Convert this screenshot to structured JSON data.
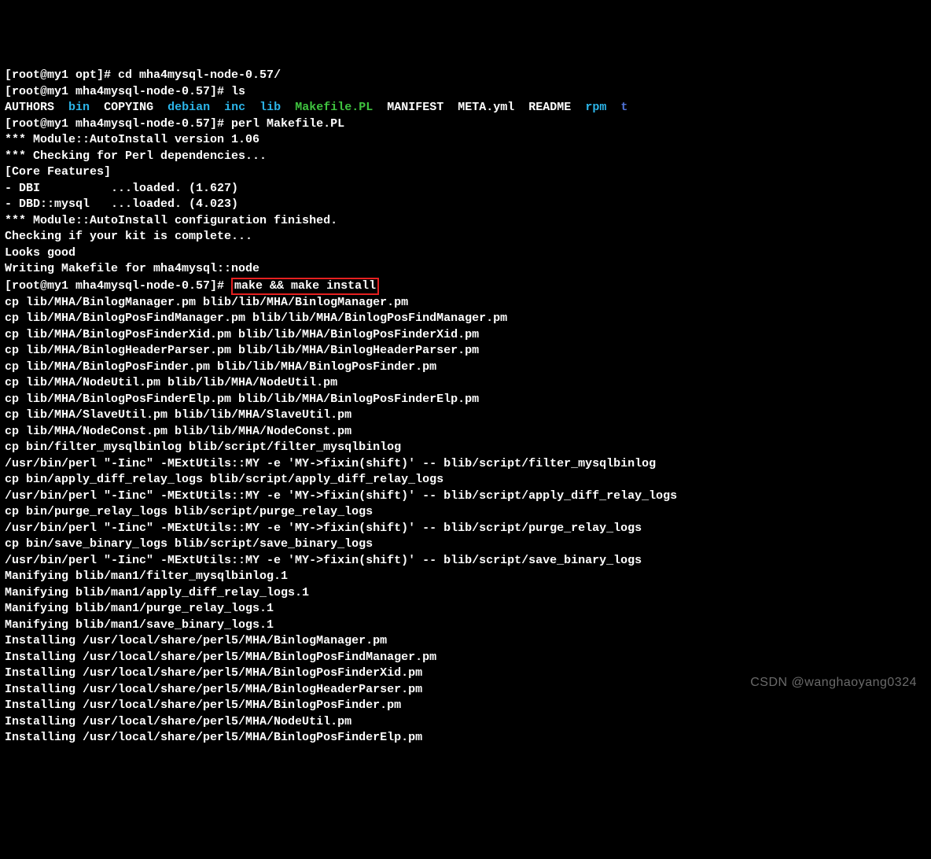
{
  "prompt1": {
    "pre": "[root@my1 opt]# ",
    "cmd": "cd mha4mysql-node-0.57/"
  },
  "prompt2": {
    "pre": "[root@my1 mha4mysql-node-0.57]# ",
    "cmd": "ls"
  },
  "ls": {
    "authors": "AUTHORS",
    "bin": "bin",
    "copying": "COPYING",
    "debian": "debian",
    "inc": "inc",
    "lib": "lib",
    "makefile": "Makefile.PL",
    "manifest": "MANIFEST",
    "metayml": "META.yml",
    "readme": "README",
    "rpm": "rpm",
    "t": "t"
  },
  "prompt3": {
    "pre": "[root@my1 mha4mysql-node-0.57]# ",
    "cmd": "perl Makefile.PL"
  },
  "perl_out": [
    "*** Module::AutoInstall version 1.06",
    "*** Checking for Perl dependencies...",
    "[Core Features]",
    "- DBI          ...loaded. (1.627)",
    "- DBD::mysql   ...loaded. (4.023)",
    "*** Module::AutoInstall configuration finished.",
    "Checking if your kit is complete...",
    "Looks good",
    "Writing Makefile for mha4mysql::node"
  ],
  "prompt4": {
    "pre": "[root@my1 mha4mysql-node-0.57]# ",
    "cmd": "make && make install"
  },
  "make_out": [
    "cp lib/MHA/BinlogManager.pm blib/lib/MHA/BinlogManager.pm",
    "cp lib/MHA/BinlogPosFindManager.pm blib/lib/MHA/BinlogPosFindManager.pm",
    "cp lib/MHA/BinlogPosFinderXid.pm blib/lib/MHA/BinlogPosFinderXid.pm",
    "cp lib/MHA/BinlogHeaderParser.pm blib/lib/MHA/BinlogHeaderParser.pm",
    "cp lib/MHA/BinlogPosFinder.pm blib/lib/MHA/BinlogPosFinder.pm",
    "cp lib/MHA/NodeUtil.pm blib/lib/MHA/NodeUtil.pm",
    "cp lib/MHA/BinlogPosFinderElp.pm blib/lib/MHA/BinlogPosFinderElp.pm",
    "cp lib/MHA/SlaveUtil.pm blib/lib/MHA/SlaveUtil.pm",
    "cp lib/MHA/NodeConst.pm blib/lib/MHA/NodeConst.pm",
    "cp bin/filter_mysqlbinlog blib/script/filter_mysqlbinlog",
    "/usr/bin/perl \"-Iinc\" -MExtUtils::MY -e 'MY->fixin(shift)' -- blib/script/filter_mysqlbinlog",
    "cp bin/apply_diff_relay_logs blib/script/apply_diff_relay_logs",
    "/usr/bin/perl \"-Iinc\" -MExtUtils::MY -e 'MY->fixin(shift)' -- blib/script/apply_diff_relay_logs",
    "cp bin/purge_relay_logs blib/script/purge_relay_logs",
    "/usr/bin/perl \"-Iinc\" -MExtUtils::MY -e 'MY->fixin(shift)' -- blib/script/purge_relay_logs",
    "cp bin/save_binary_logs blib/script/save_binary_logs",
    "/usr/bin/perl \"-Iinc\" -MExtUtils::MY -e 'MY->fixin(shift)' -- blib/script/save_binary_logs",
    "Manifying blib/man1/filter_mysqlbinlog.1",
    "Manifying blib/man1/apply_diff_relay_logs.1",
    "Manifying blib/man1/purge_relay_logs.1",
    "Manifying blib/man1/save_binary_logs.1",
    "Installing /usr/local/share/perl5/MHA/BinlogManager.pm",
    "Installing /usr/local/share/perl5/MHA/BinlogPosFindManager.pm",
    "Installing /usr/local/share/perl5/MHA/BinlogPosFinderXid.pm",
    "Installing /usr/local/share/perl5/MHA/BinlogHeaderParser.pm",
    "Installing /usr/local/share/perl5/MHA/BinlogPosFinder.pm",
    "Installing /usr/local/share/perl5/MHA/NodeUtil.pm",
    "Installing /usr/local/share/perl5/MHA/BinlogPosFinderElp.pm"
  ],
  "watermark": "CSDN @wanghaoyang0324"
}
